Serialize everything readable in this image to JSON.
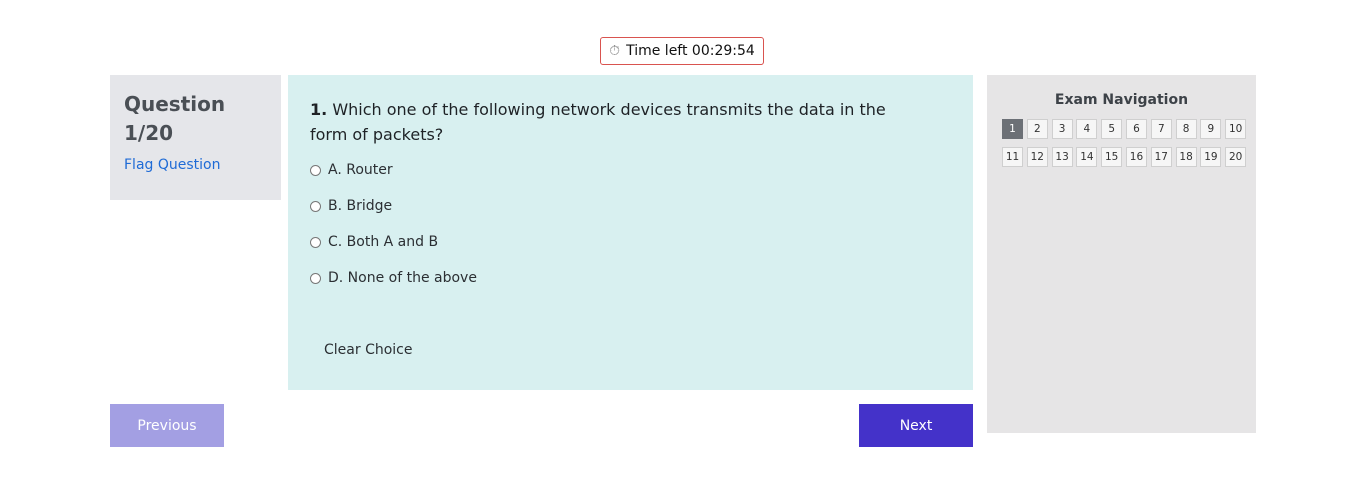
{
  "timer": {
    "icon": "stopwatch-icon",
    "label": "Time left 00:29:54"
  },
  "question_info": {
    "label": "Question 1/20",
    "flag_label": "Flag Question"
  },
  "question": {
    "number": "1.",
    "text": "Which one of the following network devices transmits the data in the form of packets?",
    "options": [
      {
        "label": "A. Router"
      },
      {
        "label": "B. Bridge"
      },
      {
        "label": "C. Both A and B"
      },
      {
        "label": "D. None of the above"
      }
    ],
    "clear_label": "Clear Choice"
  },
  "buttons": {
    "previous": "Previous",
    "next": "Next"
  },
  "navigation": {
    "title": "Exam Navigation",
    "current": "1",
    "items": [
      "1",
      "2",
      "3",
      "4",
      "5",
      "6",
      "7",
      "8",
      "9",
      "10",
      "11",
      "12",
      "13",
      "14",
      "15",
      "16",
      "17",
      "18",
      "19",
      "20"
    ]
  },
  "colors": {
    "timer_border": "#d9534f",
    "flag_link": "#1f6bd6",
    "question_bg": "#d8f0f0",
    "previous_bg": "#a39fe3",
    "next_bg": "#4432c9",
    "nav_active": "#6c7076"
  }
}
